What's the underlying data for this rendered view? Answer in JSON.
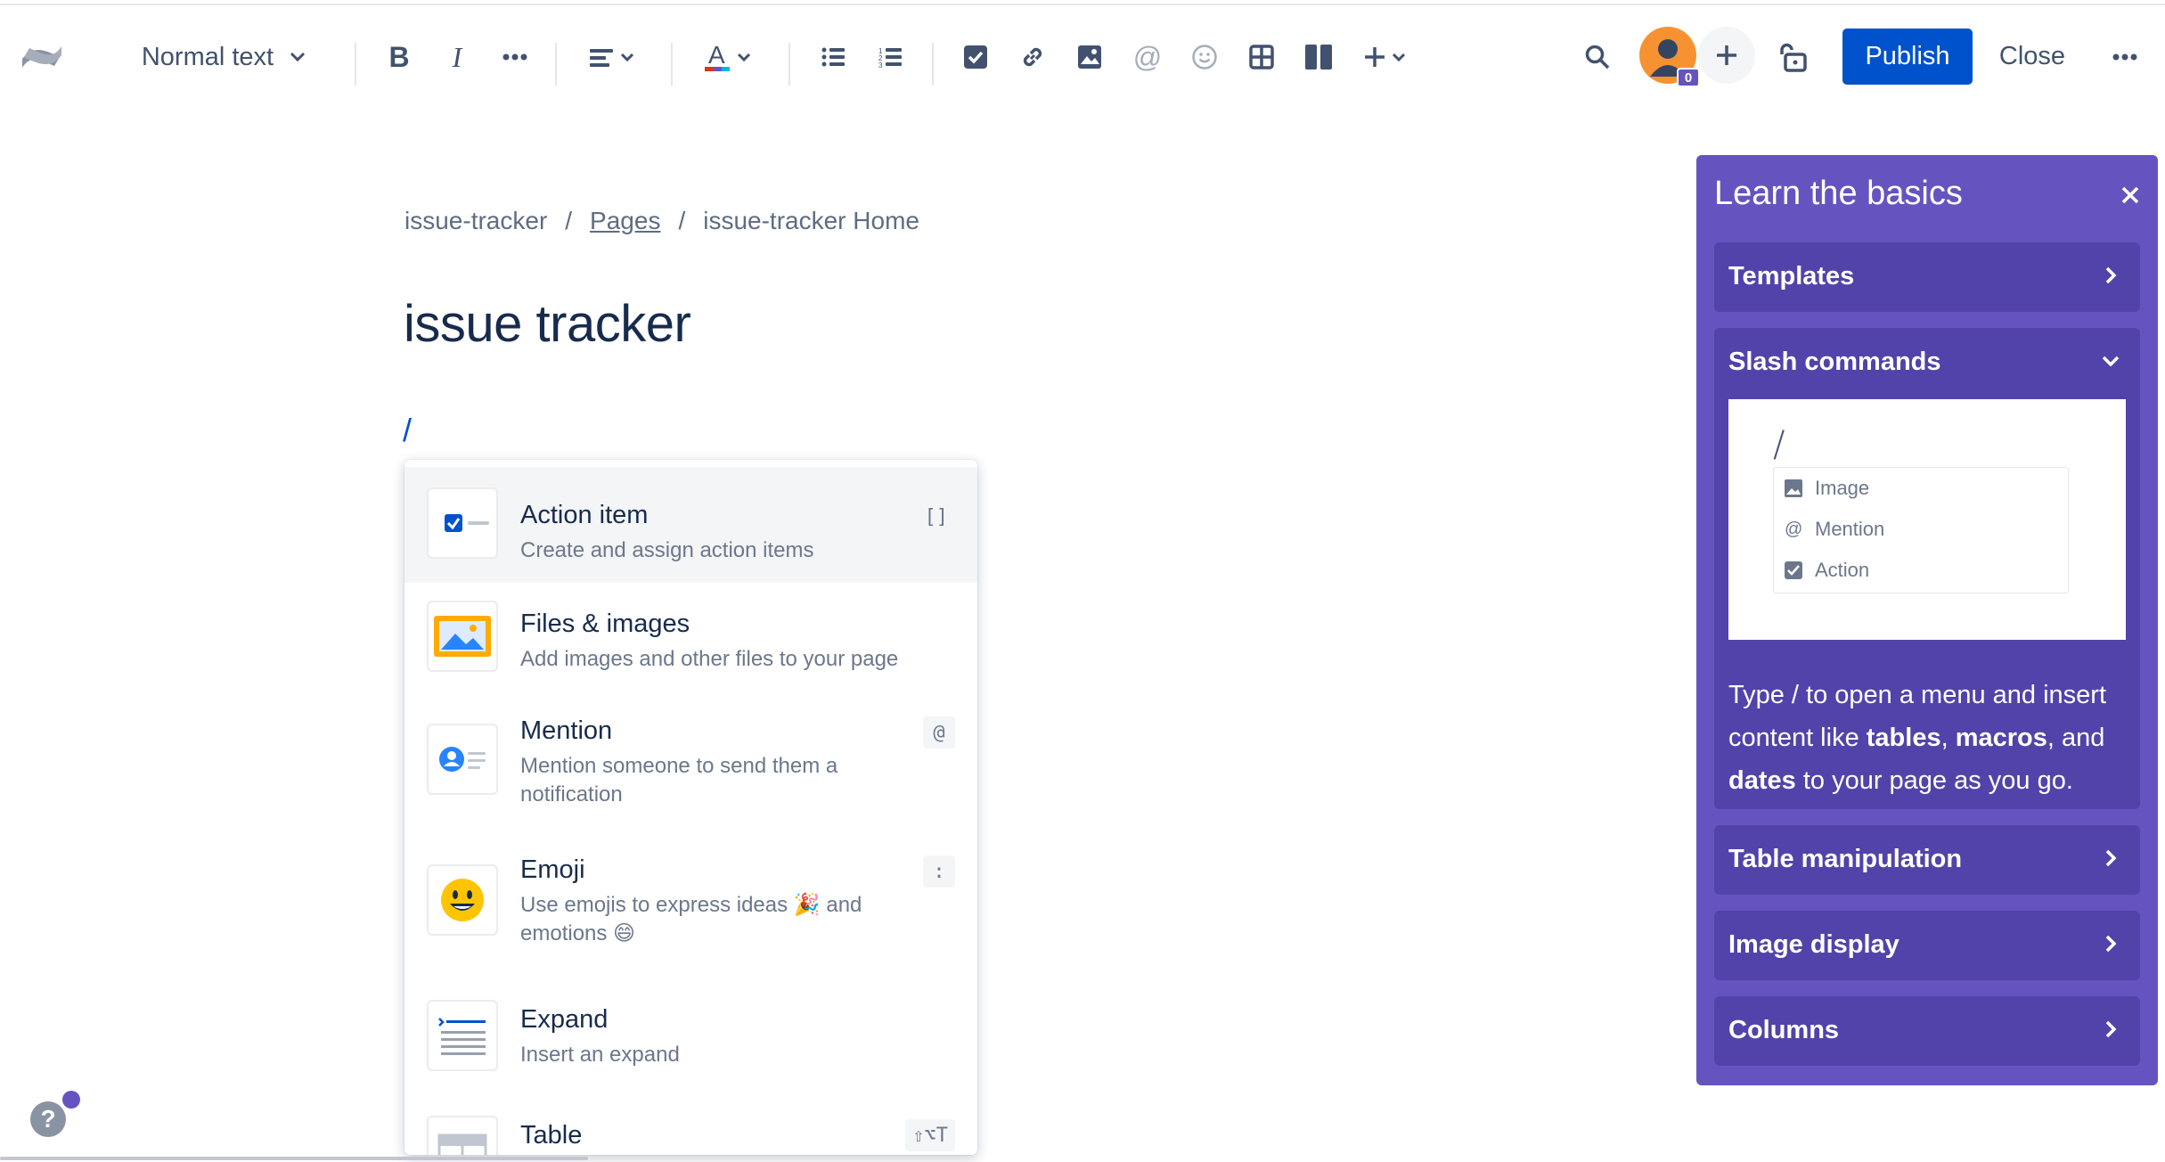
{
  "toolbar": {
    "text_style": "Normal text",
    "publish_label": "Publish",
    "close_label": "Close",
    "avatar_badge": "0",
    "icons": [
      "confluence-logo-icon",
      "bold-icon",
      "italic-icon",
      "more-formatting-icon",
      "align-icon",
      "text-color-icon",
      "bullet-list-icon",
      "numbered-list-icon",
      "action-item-icon",
      "link-icon",
      "image-icon",
      "mention-icon",
      "emoji-icon",
      "table-icon",
      "layouts-icon",
      "insert-icon",
      "search-icon",
      "invite-icon",
      "restrictions-icon",
      "more-icon"
    ]
  },
  "breadcrumb": {
    "space": "issue-tracker",
    "sep1": "/",
    "pages": "Pages",
    "sep2": "/",
    "home": "issue-tracker Home"
  },
  "page": {
    "title": "issue tracker",
    "slash": "/"
  },
  "menu": {
    "items": [
      {
        "title": "Action item",
        "desc": "Create and assign action items",
        "shortcut": "[]",
        "icon": "action-item-icon"
      },
      {
        "title": "Files & images",
        "desc": "Add images and other files to your page",
        "shortcut": "",
        "icon": "image-file-icon"
      },
      {
        "title": "Mention",
        "desc": "Mention someone to send them a notification",
        "shortcut": "@",
        "icon": "mention-icon"
      },
      {
        "title": "Emoji",
        "desc": "Use emojis to express ideas 🎉 and emotions 😄",
        "shortcut": ":",
        "icon": "smiley-icon"
      },
      {
        "title": "Expand",
        "desc": "Insert an expand",
        "shortcut": "",
        "icon": "expand-icon"
      },
      {
        "title": "Table",
        "desc": "",
        "shortcut": "⇧⌥T",
        "icon": "table-icon"
      }
    ]
  },
  "panel": {
    "title": "Learn the basics",
    "sections": [
      {
        "label": "Templates",
        "expanded": false
      },
      {
        "label": "Slash commands",
        "expanded": true
      },
      {
        "label": "Table manipulation",
        "expanded": false
      },
      {
        "label": "Image display",
        "expanded": false
      },
      {
        "label": "Columns",
        "expanded": false
      }
    ],
    "demo": {
      "slash": "/",
      "items": [
        "Image",
        "Mention",
        "Action"
      ]
    },
    "slash_text": {
      "p1": "Type / to open a menu and insert content like ",
      "b1": "tables",
      "p2": ", ",
      "b2": "macros",
      "p3": ", and ",
      "b3": "dates",
      "p4": " to your page as you go."
    }
  },
  "help": {
    "label": "?"
  },
  "colors": {
    "primary": "#0052cc",
    "panel": "#6554c0",
    "panel_section": "#5243aa",
    "avatar": "#f79232"
  }
}
